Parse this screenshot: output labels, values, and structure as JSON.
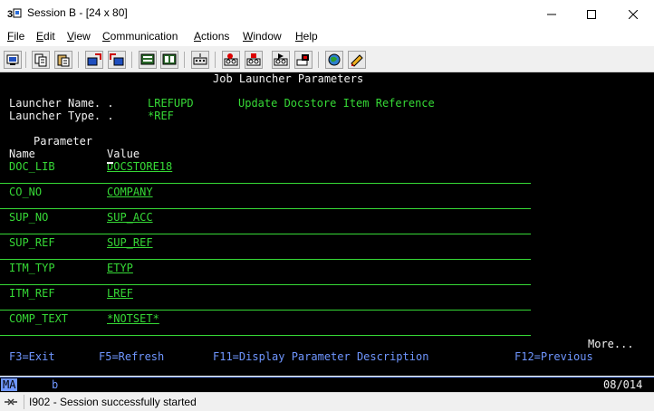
{
  "window": {
    "title": "Session B - [24 x 80]"
  },
  "menu": [
    {
      "underline": "F",
      "rest": "ile"
    },
    {
      "underline": "E",
      "rest": "dit"
    },
    {
      "underline": "V",
      "rest": "iew"
    },
    {
      "underline": "C",
      "rest": "ommunication"
    },
    {
      "underline": "A",
      "rest": "ctions"
    },
    {
      "underline": "W",
      "rest": "indow"
    },
    {
      "underline": "H",
      "rest": "elp"
    }
  ],
  "screen": {
    "title": "Job Launcher Parameters",
    "launcher_name_label": "Launcher Name. .",
    "launcher_name_value": "LREFUPD",
    "launcher_desc": "Update Docstore Item Reference",
    "launcher_type_label": "Launcher Type. .",
    "launcher_type_value": "*REF",
    "col_parameter": "Parameter",
    "col_name": "Name",
    "col_value": "Value",
    "rows": [
      {
        "name": "DOC_LIB",
        "value": "DOCSTORE18"
      },
      {
        "name": "CO_NO",
        "value": "COMPANY"
      },
      {
        "name": "SUP_NO",
        "value": "SUP_ACC"
      },
      {
        "name": "SUP_REF",
        "value": "SUP_REF"
      },
      {
        "name": "ITM_TYP",
        "value": "ETYP"
      },
      {
        "name": "ITM_REF",
        "value": "LREF"
      },
      {
        "name": "COMP_TEXT",
        "value": "*NOTSET*"
      }
    ],
    "more": "More...",
    "fkeys": {
      "f3": "F3=Exit",
      "f5": "F5=Refresh",
      "f11": "F11=Display Parameter Description",
      "f12": "F12=Previous"
    }
  },
  "oia": {
    "mode": "MA",
    "indicator": "b",
    "cursor_pos": "08/014"
  },
  "status": {
    "message": "I902 - Session successfully started"
  },
  "colors": {
    "green": "#36d936",
    "blue": "#6f96ff",
    "white": "#f2f2f2",
    "background": "#000000"
  }
}
